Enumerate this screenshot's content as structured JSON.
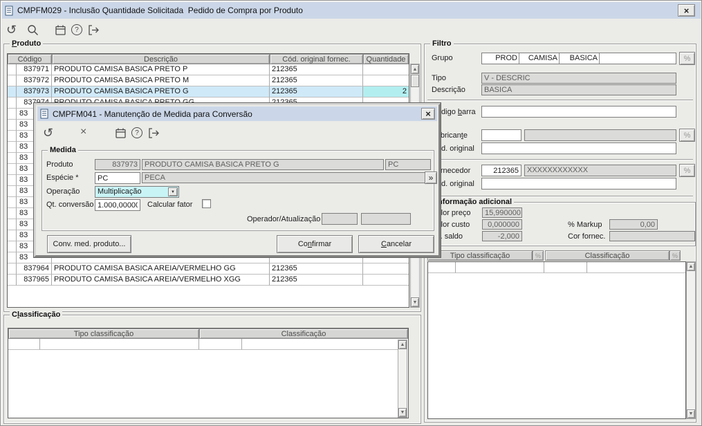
{
  "colors": {
    "titlebar": "#cbd7e8",
    "bg": "#ebebe8",
    "sel": "#cfe9f8",
    "qtysel": "#b2eef0",
    "combo": "#c9f4f6",
    "disabled": "#dbdbd9",
    "hdr": "#d6d6d4"
  },
  "window": {
    "title": "CMPFM029 - Inclusão Quantidade Solicitada  Pedido de Compra por Produto",
    "close_glyph": "×",
    "toolbar_icons": [
      "undo-icon",
      "search-icon",
      "calendar-icon",
      "help-icon",
      "exit-icon"
    ]
  },
  "product_panel": {
    "label": "Produto",
    "columns": {
      "codigo": "Código",
      "descricao": "Descrição",
      "orig": "Cód. original fornec.",
      "qtd": "Quantidade"
    },
    "rows": [
      {
        "code": "837971",
        "desc": "PRODUTO CAMISA BASICA PRETO P",
        "orig": "212365",
        "qty": ""
      },
      {
        "code": "837972",
        "desc": "PRODUTO CAMISA BASICA PRETO M",
        "orig": "212365",
        "qty": ""
      },
      {
        "code": "837973",
        "desc": "PRODUTO CAMISA BASICA PRETO G",
        "orig": "212365",
        "qty": "2",
        "selected": true
      },
      {
        "code": "837974",
        "desc": "PRODUTO CAMISA BASICA PRETO GG",
        "orig": "212365",
        "qty": ""
      },
      {
        "code": "83",
        "partial": true
      },
      {
        "code": "83",
        "partial": true
      },
      {
        "code": "83",
        "partial": true
      },
      {
        "code": "83",
        "partial": true
      },
      {
        "code": "83",
        "partial": true
      },
      {
        "code": "83",
        "partial": true
      },
      {
        "code": "83",
        "partial": true
      },
      {
        "code": "83",
        "partial": true
      },
      {
        "code": "83",
        "partial": true
      },
      {
        "code": "83",
        "partial": true
      },
      {
        "code": "83",
        "partial": true
      },
      {
        "code": "83",
        "partial": true
      },
      {
        "code": "83",
        "partial": true
      },
      {
        "code": "83",
        "partial": true
      },
      {
        "code": "837964",
        "desc": "PRODUTO CAMISA BASICA AREIA/VERMELHO GG",
        "orig": "212365",
        "qty": ""
      },
      {
        "code": "837965",
        "desc": "PRODUTO CAMISA BASICA AREIA/VERMELHO XGG",
        "orig": "212365",
        "qty": ""
      }
    ]
  },
  "classification_panel": {
    "label": "Classificação",
    "columns": {
      "tipo": "Tipo classificação",
      "classif": "Classificação"
    }
  },
  "filter_panel": {
    "label": "Filtro",
    "grupo": {
      "label": "Grupo",
      "segments": [
        "PROD",
        "CAMISA",
        "BASICA"
      ],
      "lookup_glyph": "%"
    },
    "tipo": {
      "label": "Tipo",
      "value": "V - DESCRIC"
    },
    "descricao": {
      "label": "Descrição",
      "value": "BASICA"
    },
    "codigo_barra": {
      "label": "Código barra",
      "value": ""
    },
    "fabricante": {
      "label": "Fabricante",
      "value": "",
      "desc": "",
      "lookup_glyph": "%"
    },
    "cod_original_fab": {
      "label": "Cód. original",
      "value": ""
    },
    "fornecedor": {
      "label": "Fornecedor",
      "value": "212365",
      "desc": "XXXXXXXXXXXX",
      "lookup_glyph": "%"
    },
    "cod_original_forn": {
      "label": "Cód. original",
      "value": ""
    }
  },
  "info_panel": {
    "label": "Informação adicional",
    "valor_preco": {
      "label": "Valor preço",
      "value": "15,990000"
    },
    "valor_custo": {
      "label": "Valor custo",
      "value": "0,000000"
    },
    "saldo": {
      "label": "Qt. saldo",
      "value": "-2,000"
    },
    "markup": {
      "label": "% Markup",
      "value": "0,00"
    },
    "cor_fornec": {
      "label": "Cor fornec.",
      "value": ""
    }
  },
  "right_class_table": {
    "columns": {
      "tipo": "Tipo classificação",
      "classif": "Classificação"
    },
    "lookup_glyph": "%"
  },
  "dialog": {
    "title": "CMPFM041 - Manutenção de Medida para Conversão",
    "close_glyph": "×",
    "toolbar_icons": [
      "undo-icon",
      "delete-icon",
      "calendar-icon",
      "help-icon",
      "exit-icon"
    ],
    "medida": {
      "label": "Medida",
      "produto": {
        "label": "Produto",
        "code": "837973",
        "desc": "PRODUTO CAMISA BASICA PRETO G",
        "unit": "PC"
      },
      "especie": {
        "label": "Espécie *",
        "value": "PC",
        "desc": "PECA",
        "more_glyph": "»"
      },
      "operacao": {
        "label": "Operação",
        "value": "Multiplicação"
      },
      "qt_conversao": {
        "label": "Qt. conversão",
        "value": "1.000,00000"
      },
      "calcular_fator": {
        "label": "Calcular fator",
        "checked": false
      },
      "operador": {
        "label": "Operador/Atualização",
        "value1": "",
        "value2": ""
      }
    },
    "buttons": {
      "conv": "Conv. med. produto...",
      "confirm": "Confirmar",
      "cancel": "Cancelar"
    }
  }
}
